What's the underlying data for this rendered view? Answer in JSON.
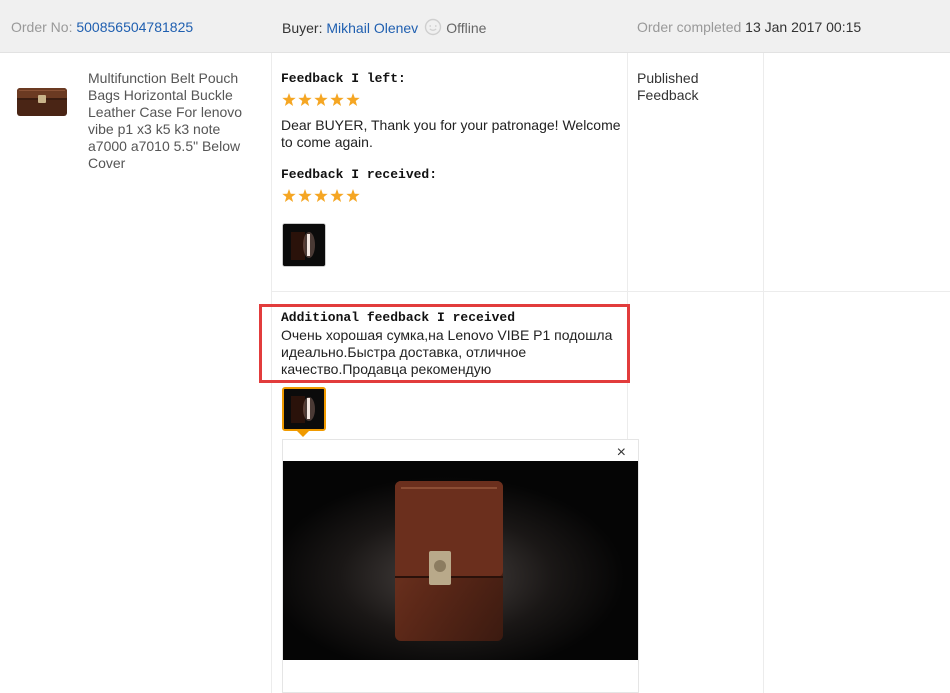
{
  "header": {
    "order_no_label": "Order No:",
    "order_no_value": "500856504781825",
    "buyer_label": "Buyer:",
    "buyer_name": "Mikhail Olenev",
    "buyer_status": "Offline",
    "order_completed_label": "Order completed",
    "order_completed_date": "13 Jan 2017 00:15"
  },
  "product": {
    "title": "Multifunction Belt Pouch Bags Horizontal Buckle Leather Case For lenovo vibe p1 x3 k5 k3 note a7000 a7010 5.5\" Below Cover"
  },
  "feedback": {
    "left_title": "Feedback I left:",
    "left_rating": 5,
    "left_text": "Dear BUYER, Thank you for your patronage! Welcome to come again.",
    "received_title": "Feedback I received:",
    "received_rating": 5,
    "additional_title": "Additional feedback I received",
    "additional_text": "Очень хорошая сумка,на Lenovo VIBE P1 подошла идеально.Быстра доставка, отличное качество.Продавца рекомендую"
  },
  "status": {
    "text": "Published Feedback"
  },
  "preview": {
    "close_label": "×"
  },
  "icons": {
    "chat": "chat-bubble-icon",
    "star": "star-icon",
    "close": "close-icon"
  },
  "colors": {
    "link": "#1f5fb0",
    "star": "#f5a623",
    "highlight": "#e23c3c",
    "thumb_active": "#f09a00",
    "header_bg": "#f0f0f0"
  }
}
